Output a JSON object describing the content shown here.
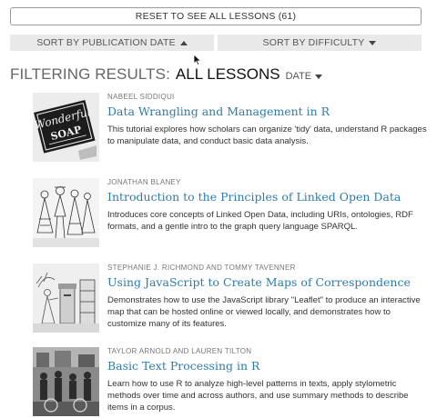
{
  "reset_button": {
    "label": "RESET TO SEE ALL LESSONS (61)"
  },
  "sort_bar": {
    "by_publication_date": "SORT BY PUBLICATION DATE",
    "by_difficulty": "SORT BY DIFFICULTY"
  },
  "filter": {
    "prefix": "FILTERING RESULTS:",
    "value": "ALL LESSONS",
    "sort_label": "DATE"
  },
  "lessons": [
    {
      "authors": "NABEEL SIDDIQUI",
      "title": "Data Wrangling and Management in R",
      "description": "This tutorial explores how scholars can organize 'tidy' data, understand R packages to manipulate data, and conduct basic data analysis.",
      "thumbnail_text": "Wonderful SOAP"
    },
    {
      "authors": "JONATHAN BLANEY",
      "title": "Introduction to the Principles of Linked Open Data",
      "description": "Introduces core concepts of Linked Open Data, including URIs, ontologies, RDF formats, and a gentle intro to the graph query language SPARQL."
    },
    {
      "authors": "STEPHANIE J. RICHMOND AND TOMMY TAVENNER",
      "title": "Using JavaScript to Create Maps of Correspondence",
      "description": "Demonstrates how to use the JavaScript library \"Leaflet\" to produce an interactive map that can be hosted online or viewed locally, and demonstrates how to customize many of its features."
    },
    {
      "authors": "TAYLOR ARNOLD AND LAUREN TILTON",
      "title": "Basic Text Processing in R",
      "description": "Learn how to use R to analyze high-level patterns in texts, apply stylometric methods over time and across authors, and use summary methods to describe items in a corpus."
    }
  ],
  "colors": {
    "link": "#2d7bb0",
    "sort_bar_bg": "#e9e9e9",
    "author_text": "#777777"
  }
}
